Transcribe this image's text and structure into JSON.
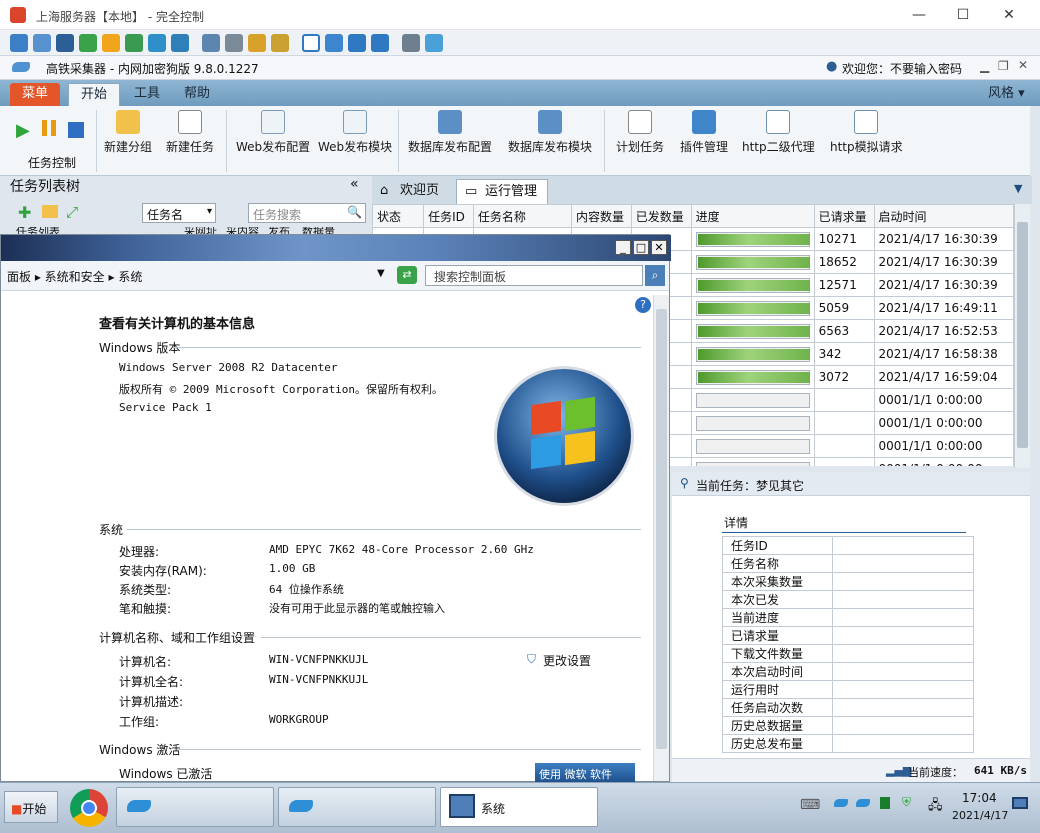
{
  "window": {
    "title": "上海服务器【本地】 - 完全控制",
    "controls": [
      "—",
      "☐",
      "✕"
    ]
  },
  "app": {
    "name": "高铁采集器 - 内网加密狗版 9.8.0.1227",
    "welcome": "欢迎您：不要输入密码"
  },
  "ribbon": {
    "tabs": [
      "菜单",
      "开始",
      "工具",
      "帮助"
    ],
    "style_label": "风格",
    "groups": {
      "task_control": "任务控制",
      "buttons": [
        "新建分组",
        "新建任务",
        "Web发布配置",
        "Web发布模块",
        "数据库发布配置",
        "数据库发布模块",
        "计划任务",
        "插件管理",
        "http二级代理",
        "http模拟请求"
      ]
    }
  },
  "left_panel": {
    "title": "任务列表树",
    "collapse": "«",
    "filter_select": "任务名",
    "search_placeholder": "任务搜索",
    "column_stub": "任务列表",
    "column_stub_cols": [
      "采网址",
      "采内容",
      "发布",
      "数据量"
    ]
  },
  "panel_tabs": [
    "欢迎页",
    "运行管理"
  ],
  "task_table": {
    "headers": [
      "状态",
      "任务ID",
      "任务名称",
      "内容数量",
      "已发数量",
      "进度",
      "已请求量",
      "启动时间"
    ],
    "rows": [
      {
        "requested": "10271",
        "start": "2021/4/17 16:30:39",
        "progress": 1.0
      },
      {
        "requested": "18652",
        "start": "2021/4/17 16:30:39",
        "progress": 1.0
      },
      {
        "requested": "12571",
        "start": "2021/4/17 16:30:39",
        "progress": 1.0
      },
      {
        "requested": "5059",
        "start": "2021/4/17 16:49:11",
        "progress": 1.0
      },
      {
        "requested": "6563",
        "start": "2021/4/17 16:52:53",
        "progress": 1.0
      },
      {
        "requested": "342",
        "start": "2021/4/17 16:58:38",
        "progress": 1.0
      },
      {
        "requested": "3072",
        "start": "2021/4/17 16:59:04",
        "progress": 1.0
      },
      {
        "requested": "",
        "start": "0001/1/1 0:00:00",
        "progress": 0
      },
      {
        "requested": "",
        "start": "0001/1/1 0:00:00",
        "progress": 0
      },
      {
        "requested": "",
        "start": "0001/1/1 0:00:00",
        "progress": 0
      },
      {
        "requested": "",
        "start": "0001/1/1 0:00:00",
        "progress": 0
      }
    ]
  },
  "current_task": "当前任务：梦见其它",
  "details": {
    "title": "详情",
    "fields": [
      "任务ID",
      "任务名称",
      "本次采集数量",
      "本次已发",
      "当前进度",
      "已请求量",
      "下载文件数量",
      "本次启动时间",
      "运行用时",
      "任务启动次数",
      "历史总数据量",
      "历史总发布量"
    ]
  },
  "status": {
    "speed_label": "当前速度：",
    "speed_value": "641 KB/s"
  },
  "system_window": {
    "breadcrumb": [
      "面板",
      "系统和安全",
      "系统"
    ],
    "search_placeholder": "搜索控制面板",
    "heading": "查看有关计算机的基本信息",
    "edition_section": "Windows 版本",
    "edition": "Windows Server 2008 R2 Datacenter",
    "copyright": "版权所有 © 2009 Microsoft Corporation。保留所有权利。",
    "service_pack": "Service Pack 1",
    "system_section": "系统",
    "system": [
      {
        "label": "处理器:",
        "value": "AMD EPYC 7K62 48-Core Processor   2.60 GHz"
      },
      {
        "label": "安装内存(RAM):",
        "value": "1.00 GB"
      },
      {
        "label": "系统类型:",
        "value": "64 位操作系统"
      },
      {
        "label": "笔和触摸:",
        "value": "没有可用于此显示器的笔或触控输入"
      }
    ],
    "computer_section": "计算机名称、域和工作组设置",
    "computer": [
      {
        "label": "计算机名:",
        "value": "WIN-VCNFPNKKUJL"
      },
      {
        "label": "计算机全名:",
        "value": "WIN-VCNFPNKKUJL"
      },
      {
        "label": "计算机描述:",
        "value": ""
      },
      {
        "label": "工作组:",
        "value": "WORKGROUP"
      }
    ],
    "change_settings": "更改设置",
    "activation_section": "Windows 激活",
    "activation": "Windows 已激活",
    "genuine_badge": "使用 微软 软件"
  },
  "taskbar": {
    "start": "开始",
    "active_task": "系统",
    "time": "17:04",
    "date": "2021/4/17"
  }
}
